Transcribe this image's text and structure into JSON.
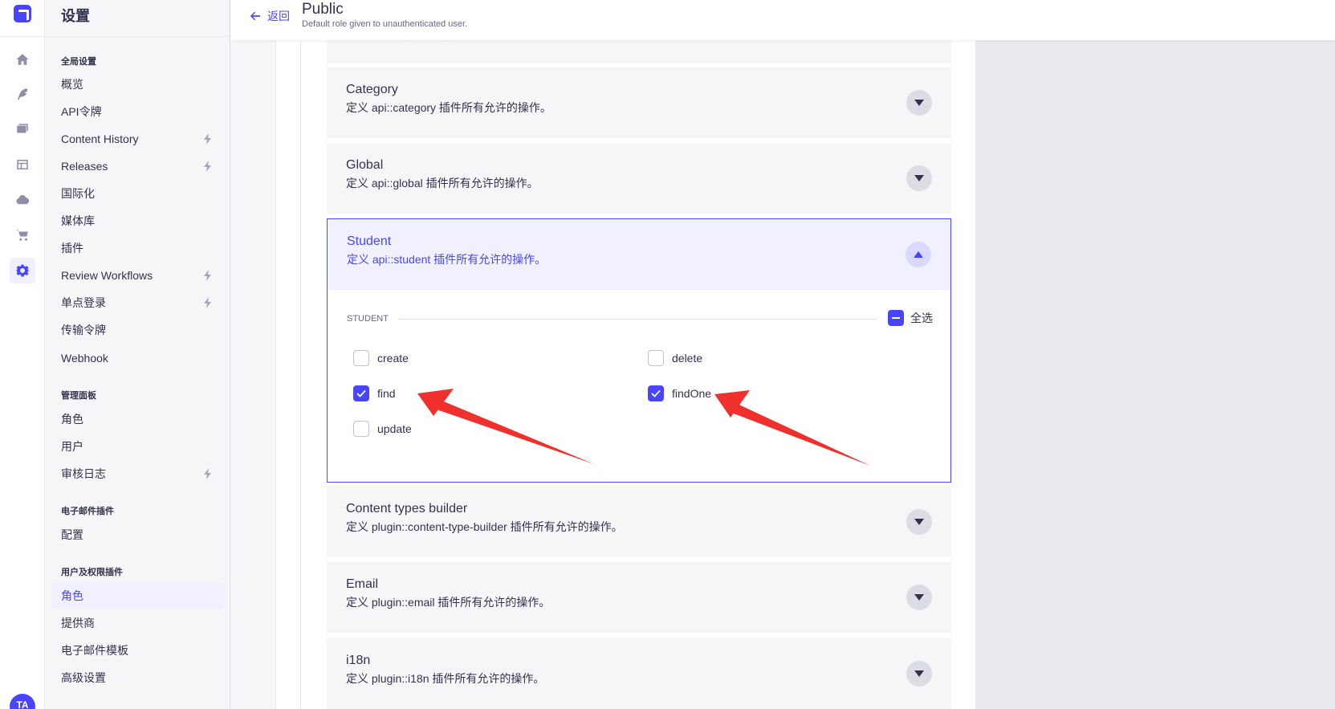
{
  "sidebar": {
    "title": "设置",
    "sections": [
      {
        "label": "全局设置",
        "items": [
          {
            "label": "概览"
          },
          {
            "label": "API令牌"
          },
          {
            "label": "Content History"
          },
          {
            "label": "Releases"
          },
          {
            "label": "国际化"
          },
          {
            "label": "媒体库"
          },
          {
            "label": "插件"
          },
          {
            "label": "Review Workflows"
          },
          {
            "label": "单点登录"
          },
          {
            "label": "传输令牌"
          },
          {
            "label": "Webhook"
          }
        ]
      },
      {
        "label": "管理面板",
        "items": [
          {
            "label": "角色"
          },
          {
            "label": "用户"
          },
          {
            "label": "审核日志"
          }
        ]
      },
      {
        "label": "电子邮件插件",
        "items": [
          {
            "label": "配置"
          }
        ]
      },
      {
        "label": "用户及权限插件",
        "items": [
          {
            "label": "角色"
          },
          {
            "label": "提供商"
          },
          {
            "label": "电子邮件模板"
          },
          {
            "label": "高级设置"
          }
        ]
      }
    ],
    "avatar_initials": "TA"
  },
  "header": {
    "back_label": "返回",
    "title": "Public",
    "subtitle": "Default role given to unauthenticated user."
  },
  "accordions": [
    {
      "title": "Category",
      "desc": "定义 api::category 插件所有允许的操作。"
    },
    {
      "title": "Global",
      "desc": "定义 api::global 插件所有允许的操作。"
    },
    {
      "title": "Student",
      "desc": "定义 api::student 插件所有允许的操作。"
    },
    {
      "title": "Content types builder",
      "desc": "定义 plugin::content-type-builder 插件所有允许的操作。"
    },
    {
      "title": "Email",
      "desc": "定义 plugin::email 插件所有允许的操作。"
    },
    {
      "title": "i18n",
      "desc": "定义 plugin::i18n 插件所有允许的操作。"
    }
  ],
  "student_permissions": {
    "section_label": "STUDENT",
    "select_all_label": "全选",
    "actions": [
      {
        "label": "create",
        "checked": false
      },
      {
        "label": "delete",
        "checked": false
      },
      {
        "label": "find",
        "checked": true
      },
      {
        "label": "findOne",
        "checked": true
      },
      {
        "label": "update",
        "checked": false
      }
    ]
  },
  "colors": {
    "primary": "#4945ff",
    "annotation": "#f0302c"
  },
  "icons": [
    "logo-icon",
    "home-icon",
    "feather-icon",
    "media-icon",
    "layout-icon",
    "cloud-icon",
    "cart-icon",
    "cog-icon",
    "bolt-icon",
    "arrow-left-icon",
    "caret-down-icon",
    "caret-up-icon",
    "check-icon",
    "minus-icon"
  ]
}
